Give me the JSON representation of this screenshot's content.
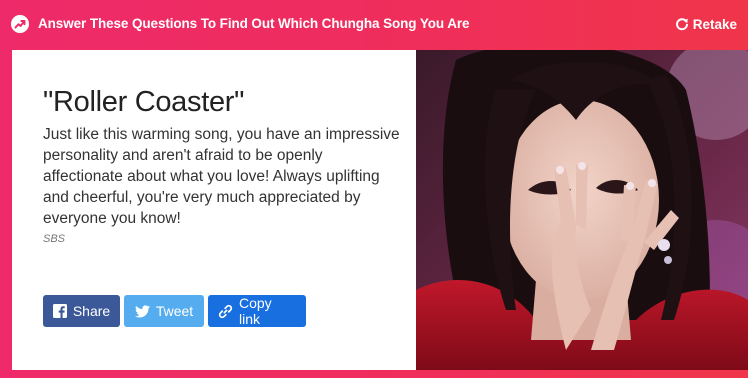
{
  "header": {
    "quiz_title": "Answer These Questions To Find Out Which Chungha Song You Are",
    "retake_label": "Retake"
  },
  "result": {
    "title": "\"Roller Coaster\"",
    "description": "Just like this warming song, you have an impressive personality and aren't afraid to be openly affectionate about what you love! Always uplifting and cheerful, you're very much appreciated by everyone you know!",
    "image_credit": "SBS"
  },
  "share": {
    "facebook_label": "Share",
    "twitter_label": "Tweet",
    "copy_label": "Copy link"
  },
  "colors": {
    "background": "#ef2d5d",
    "facebook": "#3b5998",
    "twitter": "#55acee",
    "copy_link": "#176fe0"
  },
  "image": {
    "description_icon": "result-photo"
  }
}
